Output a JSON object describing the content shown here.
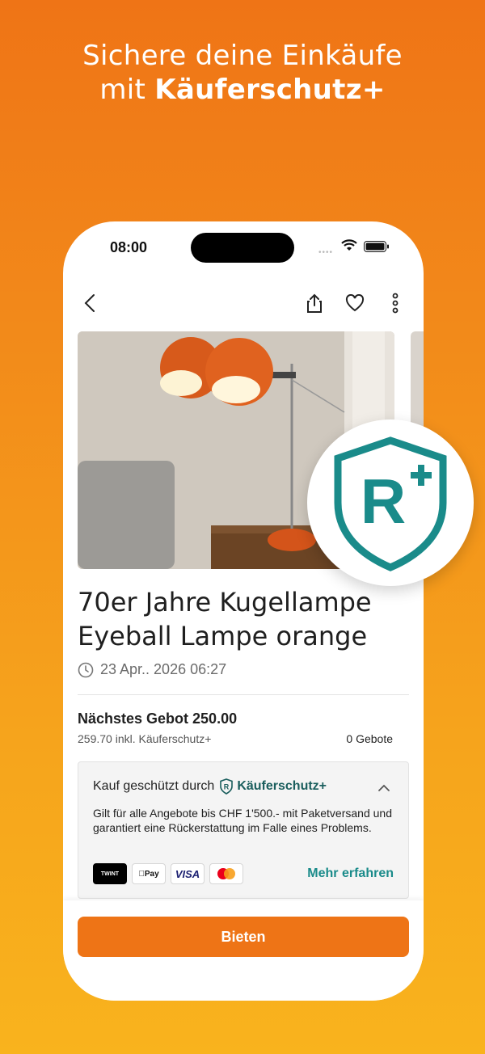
{
  "headline": {
    "line1": "Sichere deine Einkäufe",
    "line2_prefix": "mit ",
    "line2_brand": "Käuferschutz+"
  },
  "status_bar": {
    "time": "08:00"
  },
  "listing": {
    "title": "70er Jahre Kugellampe Eyeball Lampe orange",
    "date": "23 Apr.. 2026 06:27",
    "next_bid_label": "Nächstes Gebot 250.00",
    "bid_with_protection": "259.70 inkl. Käuferschutz+",
    "bid_count": "0 Gebote"
  },
  "protection": {
    "heading": "Kauf geschützt durch",
    "brand": "Käuferschutz+",
    "description": "Gilt für alle Angebote bis CHF 1'500.- mit Paketversand und garantiert eine Rückerstattung im Falle eines Problems.",
    "payment_methods": [
      "TWINT",
      "Pay",
      "VISA",
      "mastercard"
    ],
    "learn_more": "Mehr erfahren"
  },
  "actions": {
    "bid_button": "Bieten"
  },
  "icons": [
    "back-icon",
    "share-icon",
    "heart-icon",
    "more-icon",
    "clock-icon",
    "chevron-up-icon",
    "shield-r-plus-icon"
  ],
  "colors": {
    "accent": "#ee7416",
    "brand_teal": "#1a8b8a",
    "brand_dark": "#1a5e5d"
  }
}
